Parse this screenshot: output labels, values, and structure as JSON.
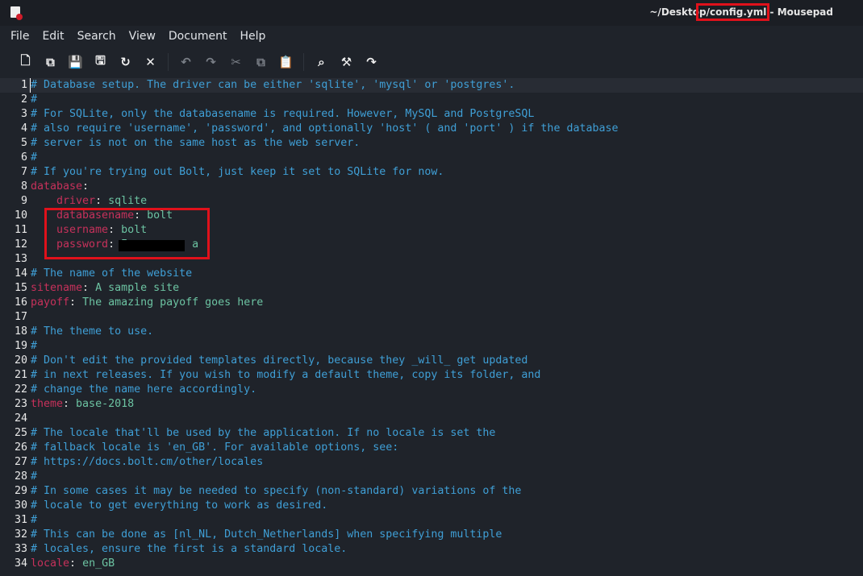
{
  "window": {
    "title_prefix": "~/Deskto",
    "title_highlight": "p/config.yml",
    "title_suffix": " - Mousepad",
    "app_icon": "mousepad-icon"
  },
  "menu": [
    "File",
    "Edit",
    "Search",
    "View",
    "Document",
    "Help"
  ],
  "toolbar": [
    {
      "icon": "new-document-icon",
      "glyph": "🗋"
    },
    {
      "icon": "new-window-icon",
      "glyph": "⧉"
    },
    {
      "icon": "save-icon",
      "glyph": "💾",
      "disabled": true
    },
    {
      "icon": "save-as-icon",
      "glyph": "🖫"
    },
    {
      "icon": "reload-icon",
      "glyph": "↻"
    },
    {
      "icon": "close-icon",
      "glyph": "✕"
    },
    {
      "sep": true
    },
    {
      "icon": "undo-icon",
      "glyph": "↶",
      "disabled": true
    },
    {
      "icon": "redo-icon",
      "glyph": "↷",
      "disabled": true
    },
    {
      "icon": "cut-icon",
      "glyph": "✂",
      "disabled": true
    },
    {
      "icon": "copy-icon",
      "glyph": "⧉",
      "disabled": true
    },
    {
      "icon": "paste-icon",
      "glyph": "📋"
    },
    {
      "sep": true
    },
    {
      "icon": "search-icon",
      "glyph": "⌕"
    },
    {
      "icon": "find-replace-icon",
      "glyph": "⚒"
    },
    {
      "icon": "go-to-line-icon",
      "glyph": "↷"
    }
  ],
  "lines": [
    [
      [
        "cm",
        "# Database setup. The driver can be either 'sqlite', 'mysql' or 'postgres'."
      ]
    ],
    [
      [
        "cm",
        "#"
      ]
    ],
    [
      [
        "cm",
        "# For SQLite, only the databasename is required. However, MySQL and PostgreSQL"
      ]
    ],
    [
      [
        "cm",
        "# also require 'username', 'password', and optionally 'host' ( and 'port' ) if the database"
      ]
    ],
    [
      [
        "cm",
        "# server is not on the same host as the web server."
      ]
    ],
    [
      [
        "cm",
        "#"
      ]
    ],
    [
      [
        "cm",
        "# If you're trying out Bolt, just keep it set to SQLite for now."
      ]
    ],
    [
      [
        "k",
        "database"
      ],
      [
        "p",
        ":"
      ]
    ],
    [
      [
        "k",
        "    driver"
      ],
      [
        "p",
        ": "
      ],
      [
        "v",
        "sqlite"
      ]
    ],
    [
      [
        "k",
        "    databasename"
      ],
      [
        "p",
        ": "
      ],
      [
        "v",
        "bolt"
      ]
    ],
    [
      [
        "k",
        "    username"
      ],
      [
        "p",
        ": "
      ],
      [
        "v",
        "bolt"
      ]
    ],
    [
      [
        "k",
        "    password"
      ],
      [
        "p",
        ": "
      ],
      [
        "v",
        "I          a"
      ]
    ],
    [],
    [
      [
        "cm",
        "# The name of the website"
      ]
    ],
    [
      [
        "k",
        "sitename"
      ],
      [
        "p",
        ": "
      ],
      [
        "v",
        "A sample site"
      ]
    ],
    [
      [
        "k",
        "payoff"
      ],
      [
        "p",
        ": "
      ],
      [
        "v",
        "The amazing payoff goes here"
      ]
    ],
    [],
    [
      [
        "cm",
        "# The theme to use."
      ]
    ],
    [
      [
        "cm",
        "#"
      ]
    ],
    [
      [
        "cm",
        "# Don't edit the provided templates directly, because they _will_ get updated"
      ]
    ],
    [
      [
        "cm",
        "# in next releases. If you wish to modify a default theme, copy its folder, and"
      ]
    ],
    [
      [
        "cm",
        "# change the name here accordingly."
      ]
    ],
    [
      [
        "k",
        "theme"
      ],
      [
        "p",
        ": "
      ],
      [
        "v",
        "base-2018"
      ]
    ],
    [],
    [
      [
        "cm",
        "# The locale that'll be used by the application. If no locale is set the"
      ]
    ],
    [
      [
        "cm",
        "# fallback locale is 'en_GB'. For available options, see:"
      ]
    ],
    [
      [
        "cm",
        "# https://docs.bolt.cm/other/locales"
      ]
    ],
    [
      [
        "cm",
        "#"
      ]
    ],
    [
      [
        "cm",
        "# In some cases it may be needed to specify (non-standard) variations of the"
      ]
    ],
    [
      [
        "cm",
        "# locale to get everything to work as desired."
      ]
    ],
    [
      [
        "cm",
        "#"
      ]
    ],
    [
      [
        "cm",
        "# This can be done as [nl_NL, Dutch_Netherlands] when specifying multiple"
      ]
    ],
    [
      [
        "cm",
        "# locales, ensure the first is a standard locale."
      ]
    ],
    [
      [
        "k",
        "locale"
      ],
      [
        "p",
        ": "
      ],
      [
        "v",
        "en_GB"
      ]
    ]
  ]
}
